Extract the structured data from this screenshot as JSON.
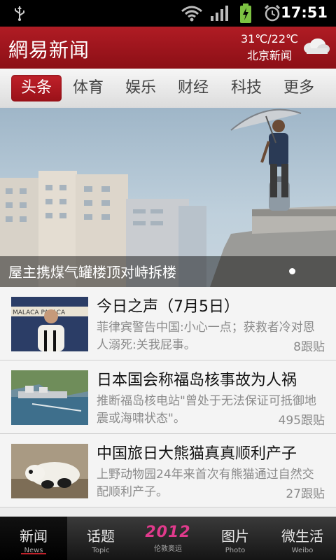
{
  "status_bar": {
    "time": "17:51"
  },
  "header": {
    "logo": "網易新闻",
    "temperature": "31℃/22℃",
    "location": "北京新闻"
  },
  "tabs": [
    "头条",
    "体育",
    "娱乐",
    "财经",
    "科技",
    "更多"
  ],
  "active_tab": 0,
  "hero": {
    "caption": "屋主携煤气罐楼顶对峙拆楼"
  },
  "news": [
    {
      "title": "今日之声（7月5日）",
      "summary": "菲律宾警告中国:小心一点；获救者冷对恩人溺死:关我屁事。",
      "replies": "8跟贴"
    },
    {
      "title": "日本国会称福岛核事故为人祸",
      "summary": "推断福岛核电站\"曾处于无法保证可抵御地震或海啸状态\"。",
      "replies": "495跟贴"
    },
    {
      "title": "中国旅日大熊猫真真顺利产子",
      "summary": "上野动物园24年来首次有熊猫通过自然交配顺利产子。",
      "replies": "27跟贴"
    }
  ],
  "thumb_text": {
    "podium": "MALACA PALACA"
  },
  "bottom_nav": [
    {
      "cn": "新闻",
      "en": "News"
    },
    {
      "cn": "话题",
      "en": "Topic"
    },
    {
      "cn": "2012",
      "en": "伦敦奥运"
    },
    {
      "cn": "图片",
      "en": "Photo"
    },
    {
      "cn": "微生活",
      "en": "Weibo"
    }
  ],
  "colors": {
    "brand_red": "#b01c24",
    "nav_dark": "#151515",
    "olympic_pink": "#e03a8c"
  }
}
